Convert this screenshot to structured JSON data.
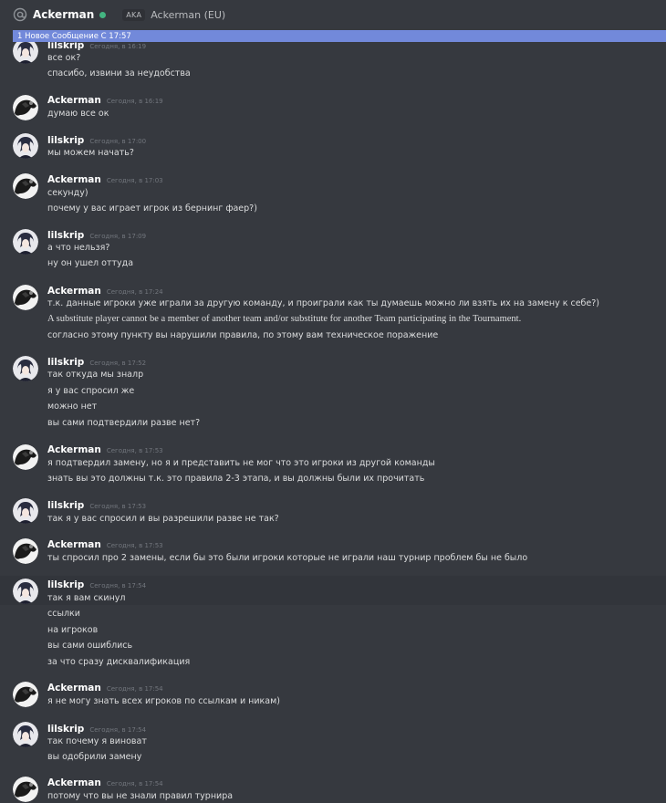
{
  "header": {
    "username": "Ackerman",
    "aka_label": "AKA",
    "aka_value": "Ackerman (EU)"
  },
  "new_messages_bar": "1 Новое Сообщение С 17:57",
  "colors": {
    "accent": "#7289da",
    "online": "#43b581",
    "background": "#36393f"
  },
  "messages": [
    {
      "author": "lilskrip",
      "time": "Сегодня, в 16:19",
      "lines": [
        "все ок?",
        "спасибо, извини за неудобства"
      ]
    },
    {
      "author": "Ackerman",
      "time": "Сегодня, в 16:19",
      "lines": [
        "думаю все ок"
      ]
    },
    {
      "author": "lilskrip",
      "time": "Сегодня, в 17:00",
      "lines": [
        "мы можем начать?"
      ]
    },
    {
      "author": "Ackerman",
      "time": "Сегодня, в 17:03",
      "lines": [
        "секунду)",
        "почему у вас играет игрок из бернинг фаер?)"
      ]
    },
    {
      "author": "lilskrip",
      "time": "Сегодня, в 17:09",
      "lines": [
        "а что нельзя?",
        "ну он ушел оттуда"
      ]
    },
    {
      "author": "Ackerman",
      "time": "Сегодня, в 17:24",
      "lines": [
        "т.к. данные игроки уже играли за другую команду, и проиграли как ты думаешь можно ли взять их на замену к себе?)",
        "A substitute player cannot be a member of another team and/or substitute for another Team participating in the Tournament.",
        "согласно этому пункту вы нарушили правила, по этому вам техническое поражение"
      ]
    },
    {
      "author": "lilskrip",
      "time": "Сегодня, в 17:52",
      "lines": [
        "так откуда мы зналр",
        "я у вас спросил же",
        "можно нет",
        "вы сами подтвердили разве нет?"
      ]
    },
    {
      "author": "Ackerman",
      "time": "Сегодня, в 17:53",
      "lines": [
        "я подтвердил замену, но я и представить не мог что это игроки из другой команды",
        "знать вы это должны т.к. это правила 2-3 этапа, и вы должны были их прочитать"
      ]
    },
    {
      "author": "lilskrip",
      "time": "Сегодня, в 17:53",
      "lines": [
        "так я у вас спросил и вы разрешили разве не так?"
      ]
    },
    {
      "author": "Ackerman",
      "time": "Сегодня, в 17:53",
      "lines": [
        "ты спросил про 2 замены, если бы это были игроки которые не играли наш турнир проблем бы не было"
      ]
    },
    {
      "author": "lilskrip",
      "time": "Сегодня, в 17:54",
      "lines": [
        "так я вам скинул",
        "ссылки",
        "на игроков",
        "вы сами ошиблись",
        "за что сразу дисквалификация"
      ]
    },
    {
      "author": "Ackerman",
      "time": "Сегодня, в 17:54",
      "lines": [
        "я не могу знать всех игроков по ссылкам и никам)"
      ]
    },
    {
      "author": "lilskrip",
      "time": "Сегодня, в 17:54",
      "lines": [
        "так почему я виноват",
        "вы одобрили замену"
      ]
    },
    {
      "author": "Ackerman",
      "time": "Сегодня, в 17:54",
      "lines": [
        "потому что вы не знали правил турнира"
      ]
    }
  ]
}
